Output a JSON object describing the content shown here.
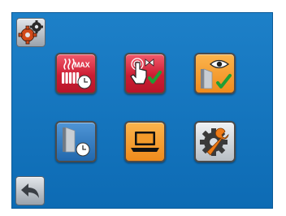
{
  "screen": {
    "background": "#1276c0"
  },
  "toolbar": {
    "settings_icon": "gears-icon",
    "back_icon": "back-arrow-icon"
  },
  "tiles": [
    {
      "name": "max-heating-timer",
      "icon": "heater-max-clock-icon",
      "label": "MAX",
      "color": "#d92a3f"
    },
    {
      "name": "valve-touch-check",
      "icon": "touch-valve-check-icon",
      "color": "#d92a3f"
    },
    {
      "name": "window-view-check",
      "icon": "eye-window-check-icon",
      "color": "#f39a2a"
    },
    {
      "name": "window-timer",
      "icon": "window-clock-icon",
      "color": "#2f78bf"
    },
    {
      "name": "laptop-connect",
      "icon": "laptop-icon",
      "color": "#f39a2a"
    },
    {
      "name": "service-settings",
      "icon": "gear-wrench-icon",
      "color": "#c9ced4"
    }
  ]
}
